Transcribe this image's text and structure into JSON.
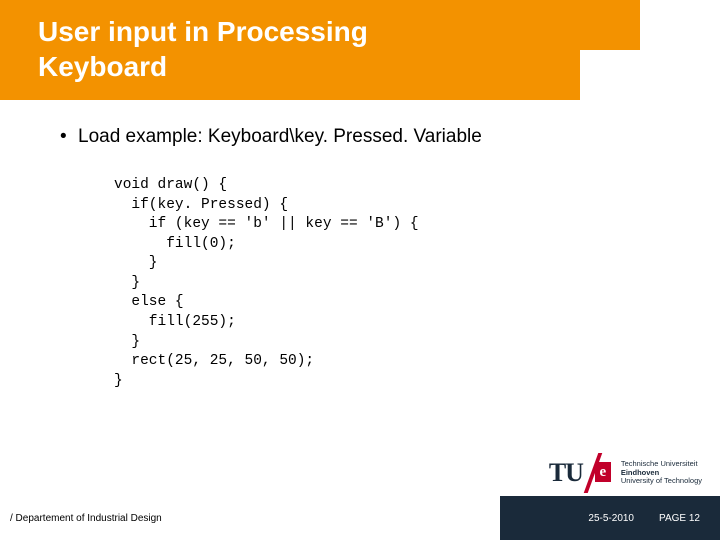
{
  "title": {
    "line1": "User input in Processing",
    "line2": "Keyboard"
  },
  "bullet1": "Load example: Keyboard\\key. Pressed. Variable",
  "code": "void draw() {\n  if(key. Pressed) {\n    if (key == 'b' || key == 'B') {\n      fill(0);\n    }\n  }\n  else {\n    fill(255);\n  }\n  rect(25, 25, 50, 50);\n}",
  "footer": {
    "dept": "/ Departement of Industrial Design",
    "date": "25-5-2010",
    "page": "PAGE 12"
  },
  "logo": {
    "mark": "TU",
    "e": "e",
    "line1": "Technische Universiteit",
    "line2": "Eindhoven",
    "line3": "University of Technology"
  }
}
